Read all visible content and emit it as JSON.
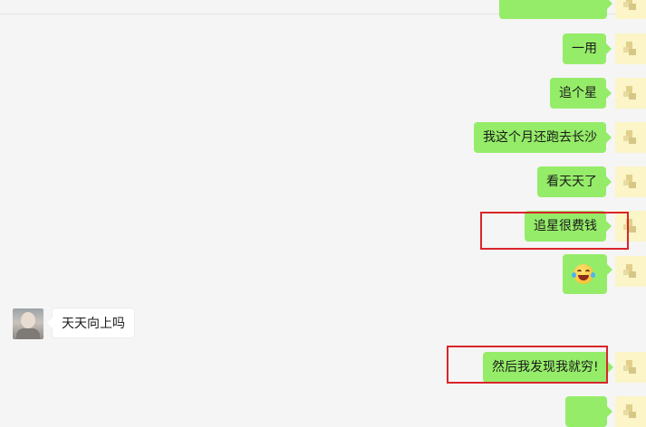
{
  "chat": {
    "messages": [
      {
        "id": "partial-top",
        "side": "me",
        "text": ""
      },
      {
        "id": "yiyong",
        "side": "me",
        "text": "一用"
      },
      {
        "id": "zhuigexing",
        "side": "me",
        "text": "追个星"
      },
      {
        "id": "changsha",
        "side": "me",
        "text": "我这个月还跑去长沙"
      },
      {
        "id": "kantiantian",
        "side": "me",
        "text": "看天天了"
      },
      {
        "id": "hen-feiqian",
        "side": "me",
        "text": "追星很费钱"
      },
      {
        "id": "emoji",
        "side": "me",
        "emoji": "rolling-on-floor-laughing"
      },
      {
        "id": "tiantian-xiangshang",
        "side": "other",
        "text": "天天向上吗"
      },
      {
        "id": "qiong",
        "side": "me",
        "text": "然后我发现我就穷!"
      }
    ]
  },
  "colors": {
    "my_bubble": "#95ec69",
    "other_bubble": "#ffffff",
    "background": "#f5f5f5",
    "highlight_box": "#d9252a"
  }
}
